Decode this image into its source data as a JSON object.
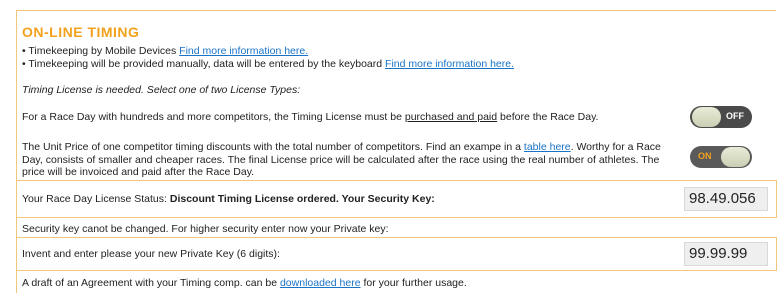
{
  "section": {
    "title": "ON-LINE TIMING",
    "bullets": [
      {
        "text": "• Timekeeping by Mobile Devices ",
        "link": "Find more information here."
      },
      {
        "text": "• Timekeeping will be provided manually, data will be entered by the keyboard ",
        "link": "Find more information here."
      }
    ],
    "note": "Timing License is needed. Select one of two License Types:",
    "option1": {
      "text_before": "For a Race Day with hundreds and more competitors, the Timing License must be ",
      "underlined": "purchased and paid",
      "text_after": " before the Race Day.",
      "toggle_label": "OFF"
    },
    "option2": {
      "text_before": "The Unit Price of one competitor timing discounts with the total number of competitors. Find an exampe in a ",
      "link": "table here",
      "text_after": ". Worthy for a Race Day, consists of smaller and cheaper races. The final License price will be calculated after the race using the real number of athletes. The price will be invoiced and paid after the Race Day.",
      "toggle_label": "ON"
    },
    "status": {
      "label": "Your Race Day License Status: ",
      "value": "Discount Timing License ordered. Your Security Key:",
      "security_key": "98.49.056"
    },
    "security_note": "Security key canot be changed. For higher security enter now your Private key:",
    "private_key": {
      "label": "Invent and enter please your new Private Key (6 digits):",
      "value": "99.99.99"
    },
    "agreement": {
      "text_before": "A draft of an Agreement with your Timing comp. can be ",
      "link": "downloaded here",
      "text_after": " for your further usage."
    }
  },
  "colors": {
    "accent": "#f3a11c",
    "border": "#f2c77a",
    "link": "#1a73c7"
  }
}
